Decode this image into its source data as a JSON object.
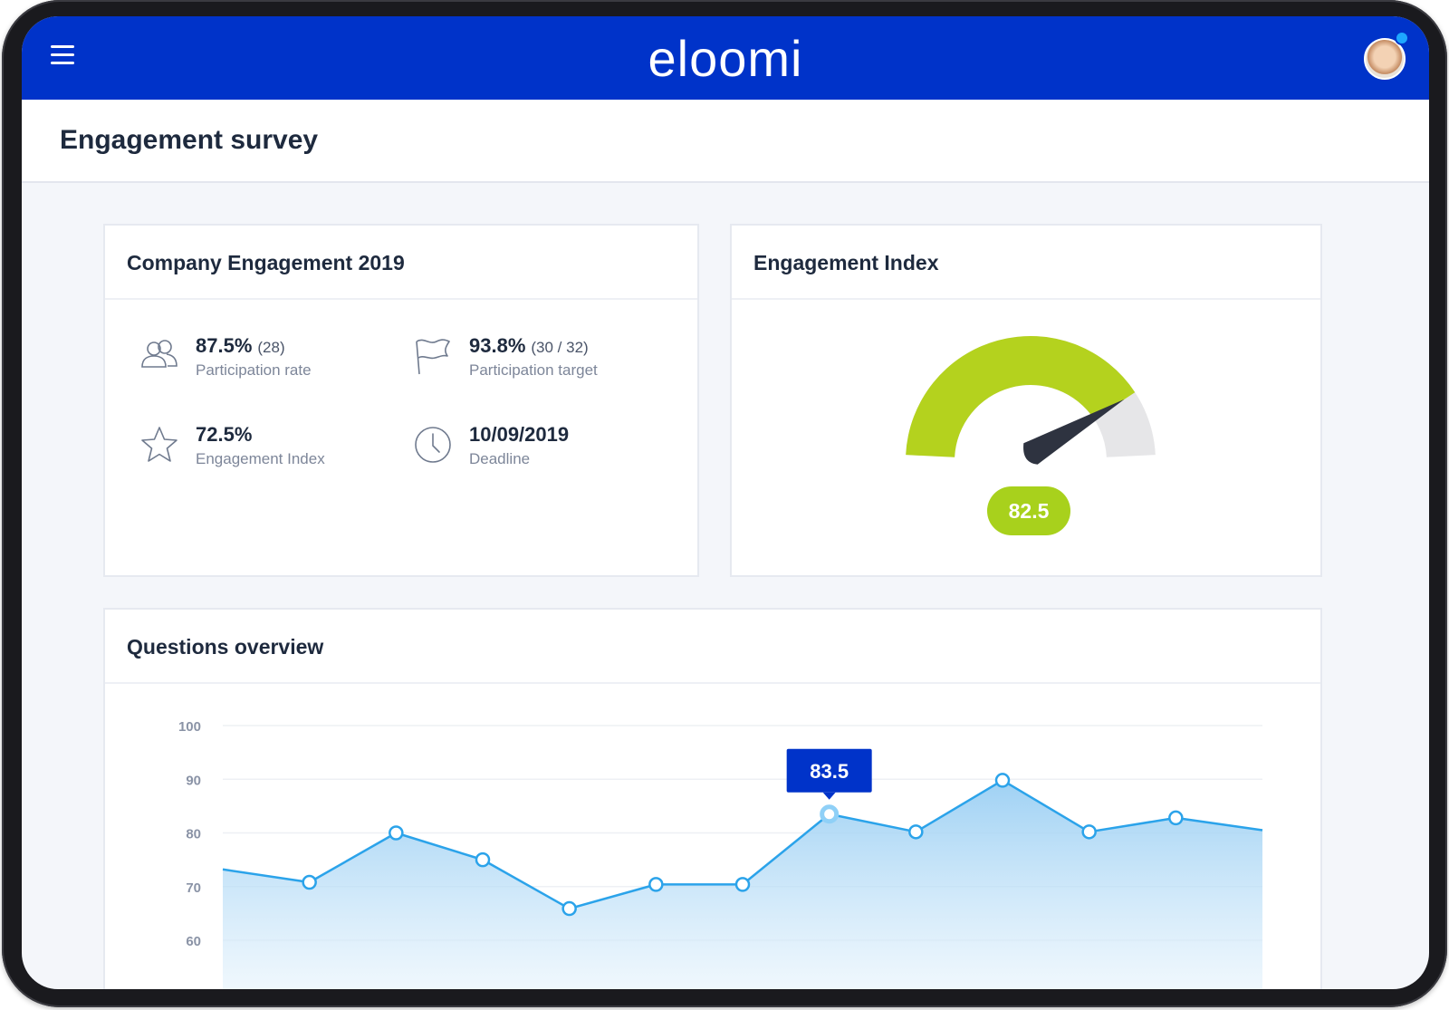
{
  "app": {
    "logo": "eloomi"
  },
  "header": {
    "title": "Engagement survey"
  },
  "icons": {
    "menu": "hamburger-menu-icon",
    "avatar": "user-avatar",
    "participation": "people-icon",
    "target": "flag-icon",
    "index": "star-icon",
    "deadline": "clock-icon"
  },
  "colors": {
    "brand": "#0033c9",
    "accent_green": "#a8d11c",
    "line_blue": "#2ba3ea"
  },
  "company_card": {
    "title": "Company Engagement 2019",
    "stats": [
      {
        "value": "87.5%",
        "sub": "(28)",
        "label": "Participation rate"
      },
      {
        "value": "93.8%",
        "sub": "(30 / 32)",
        "label": "Participation target"
      },
      {
        "value": "72.5%",
        "sub": "",
        "label": "Engagement Index"
      },
      {
        "value": "10/09/2019",
        "sub": "",
        "label": "Deadline"
      }
    ]
  },
  "index_card": {
    "title": "Engagement Index",
    "gauge_value": "82.5",
    "gauge_fraction": 0.825
  },
  "questions_card": {
    "title": "Questions overview",
    "tooltip": "83.5"
  },
  "chart_data": {
    "type": "area",
    "title": "",
    "xlabel": "",
    "ylabel": "",
    "ylim": [
      60,
      100
    ],
    "yticks": [
      "100",
      "90",
      "80",
      "70",
      "60"
    ],
    "grid": true,
    "series": [
      {
        "values": [
          73.2,
          70.8,
          80,
          75,
          65.9,
          70.4,
          70.4,
          83.5,
          80.2,
          89.8,
          80.2,
          82.8,
          80.5
        ]
      }
    ],
    "markers": [
      false,
      true,
      true,
      true,
      true,
      true,
      true,
      true,
      true,
      true,
      true,
      true,
      false
    ],
    "highlight_index": 7
  }
}
